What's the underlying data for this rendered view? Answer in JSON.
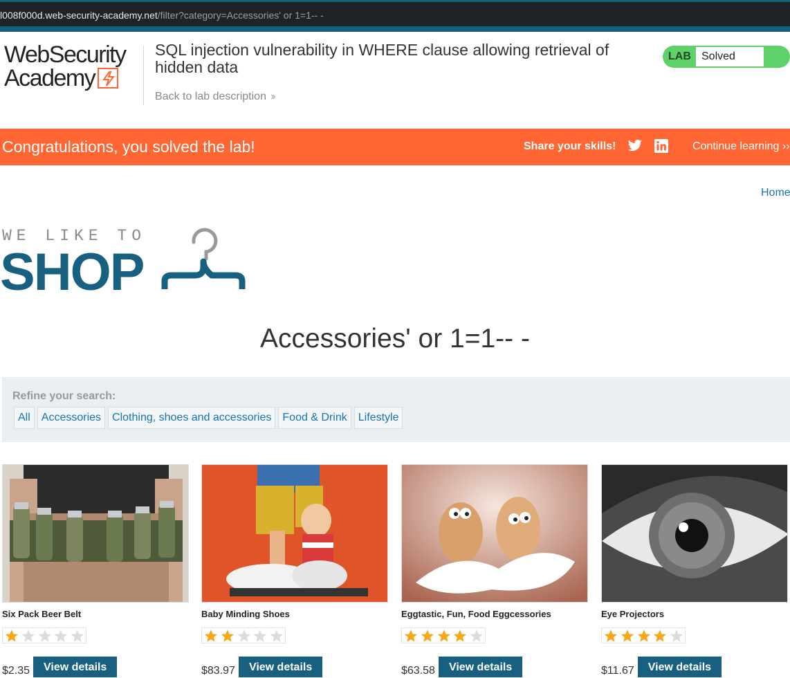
{
  "browser": {
    "url_host": "l008f000d.web-security-academy.net",
    "url_path": "/filter?category=Accessories' or 1=1-- -"
  },
  "header": {
    "logo_line1": "WebSecurity",
    "logo_line2": "Academy",
    "lab_title": "SQL injection vulnerability in WHERE clause allowing retrieval of hidden data",
    "back_link": "Back to lab description",
    "lab_badge": "LAB",
    "lab_state": "Solved"
  },
  "banner": {
    "message": "Congratulations, you solved the lab!",
    "share": "Share your skills!",
    "continue": "Continue learning"
  },
  "nav": {
    "home": "Home"
  },
  "shop_logo": {
    "small": "WE LIKE TO",
    "big": "SHOP"
  },
  "page_heading": "Accessories' or 1=1-- -",
  "filter": {
    "label": "Refine your search:",
    "categories": [
      "All",
      "Accessories",
      "Clothing, shoes and accessories",
      "Food & Drink",
      "Lifestyle"
    ]
  },
  "products": [
    {
      "name": "Six Pack Beer Belt",
      "rating": 1,
      "price": "$2.35",
      "button": "View details"
    },
    {
      "name": "Baby Minding Shoes",
      "rating": 2,
      "price": "$83.97",
      "button": "View details"
    },
    {
      "name": "Eggtastic, Fun, Food Eggcessories",
      "rating": 4,
      "price": "$63.58",
      "button": "View details"
    },
    {
      "name": "Eye Projectors",
      "rating": 4,
      "price": "$11.67",
      "button": "View details"
    }
  ],
  "colors": {
    "accent_orange": "#ff6633",
    "brand_blue": "#17607f",
    "link_blue": "#1a72b0",
    "solved_green": "#5fd16b",
    "star_gold": "#f6a81b",
    "star_empty": "#dcdcdc"
  }
}
